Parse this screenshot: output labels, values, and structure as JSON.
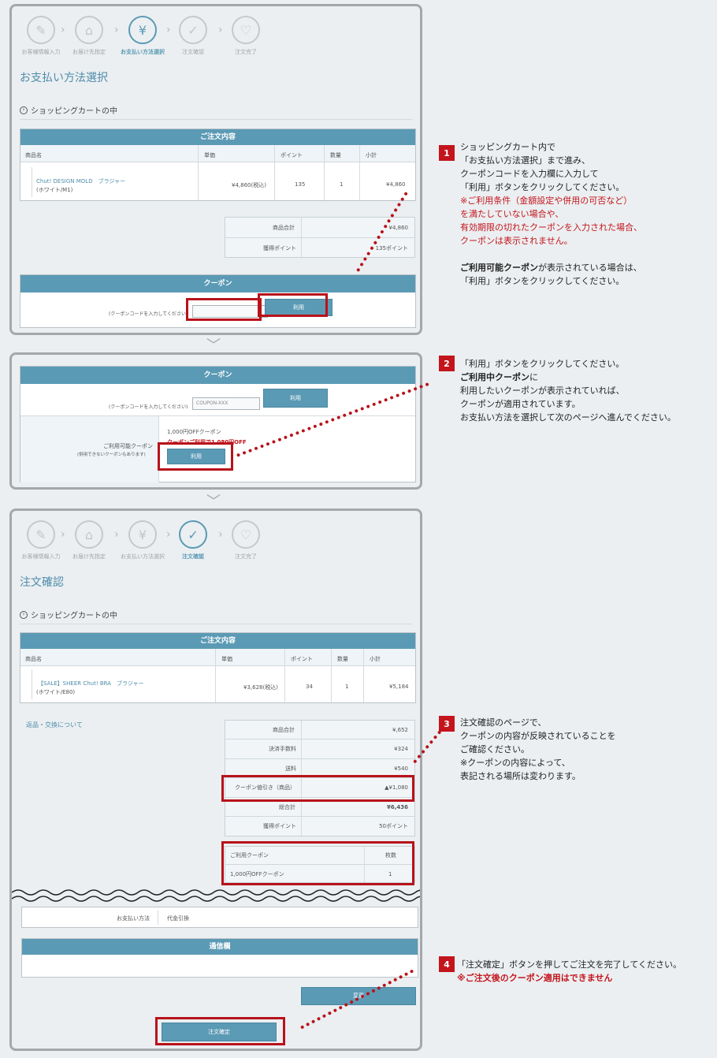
{
  "steps": [
    "お客様情報入力",
    "お届け先指定",
    "お支払い方法選択",
    "注文確認",
    "注文完了"
  ],
  "panel1": {
    "title": "お支払い方法選択",
    "section": "ショッピングカートの中",
    "order_header": "ご注文内容",
    "cols": [
      "商品名",
      "単価",
      "ポイント",
      "数量",
      "小計"
    ],
    "product_name": "Chut! DESIGN MOLD　ブラジャー",
    "product_variant": "(ホワイト/M1)",
    "price": "¥4,860(税込)",
    "points": "135",
    "qty": "1",
    "subtotal": "¥4,860",
    "sum_label1": "商品合計",
    "sum_val1": "¥4,860",
    "sum_label2": "獲得ポイント",
    "sum_val2": "135ポイント",
    "coupon_header": "クーポン",
    "coupon_prompt": "(クーポンコードを入力してください)",
    "use_btn": "利用"
  },
  "panel2": {
    "coupon_header": "クーポン",
    "coupon_prompt": "(クーポンコードを入力してください)",
    "coupon_code": "COUPON-XXX",
    "use_btn": "利用",
    "avail_label": "ご利用可能クーポン",
    "avail_sub": "(併用できないクーポンもあります)",
    "coupon_name": "1,000円OFFクーポン",
    "coupon_applied": "クーポンご利用で1,080円OFF",
    "use_btn2": "利用"
  },
  "panel3": {
    "title": "注文確認",
    "section": "ショッピングカートの中",
    "order_header": "ご注文内容",
    "cols": [
      "商品名",
      "単価",
      "ポイント",
      "数量",
      "小計"
    ],
    "product_name": "【SALE】SHEER Chut! BRA　ブラジャー",
    "product_variant": "(ホワイト/E80)",
    "price": "¥3,628(税込)",
    "points": "34",
    "qty": "1",
    "subtotal": "¥5,184",
    "returns_link": "返品・交換について",
    "summary": [
      {
        "label": "商品合計",
        "value": "¥,652"
      },
      {
        "label": "決済手数料",
        "value": "¥324"
      },
      {
        "label": "送料",
        "value": "¥540"
      },
      {
        "label": "クーポン値引き（商品）",
        "value": "▲¥1,080"
      },
      {
        "label": "総合計",
        "value": "¥6,436"
      },
      {
        "label": "獲得ポイント",
        "value": "50ポイント"
      }
    ],
    "used_coupon_header": "ご利用クーポン",
    "used_coupon_count_header": "枚数",
    "used_coupon_name": "1,000円OFFクーポン",
    "used_coupon_count": "1",
    "payment_label": "お支払い方法",
    "payment_value": "代金引換",
    "comm_header": "通信欄",
    "change_btn": "変更",
    "confirm_btn": "注文確定"
  },
  "notes": [
    {
      "num": "1",
      "plain1": "ショッピングカート内で\n「お支払い方法選択」まで進み、\nクーポンコードを入力欄に入力して\n「利用」ボタンをクリックしてください。",
      "red": "※ご利用条件（金額設定や併用の可否など）\nを満たしていない場合や、\n有効期限の切れたクーポンを入力された場合、\nクーポンは表示されません。",
      "bold": "ご利用可能クーポン",
      "plain2": "が表示されている場合は、\n「利用」ボタンをクリックしてください。"
    },
    {
      "num": "2",
      "plain1": "「利用」ボタンをクリックしてください。",
      "bold": "ご利用中クーポン",
      "plain2": "に\n利用したいクーポンが表示されていれば、\nクーポンが適用されています。\nお支払い方法を選択して次のページへ進んでください。"
    },
    {
      "num": "3",
      "plain1": "注文確認のページで、\nクーポンの内容が反映されていることを\nご確認ください。\n※クーポンの内容によって、\n表記される場所は変わります。"
    },
    {
      "num": "4",
      "plain1": "「注文確定」ボタンを押してご注文を完了してください。",
      "red": "※ご注文後のクーポン適用はできません"
    }
  ]
}
